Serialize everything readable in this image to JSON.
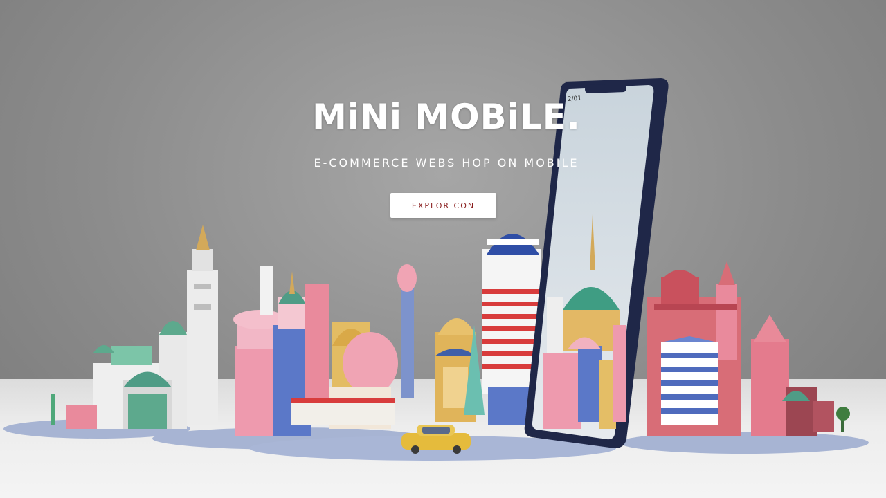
{
  "hero": {
    "title": "MiNi MOBiLE.",
    "subtitle": "E-COMMERCE WEBS HOP ON MOBILE",
    "cta_label": "EXPLOR CON"
  },
  "colors": {
    "background": "#8c8c8c",
    "title": "#ffffff",
    "cta_text": "#8a1f1f",
    "pink": "#e98a9c",
    "teal": "#4f9c86",
    "navy": "#1e2750",
    "gold": "#e0b45a"
  },
  "scene": {
    "description_icons": [
      "city-skyline-illustration",
      "smartphone-illustration",
      "yellow-car-illustration"
    ]
  }
}
